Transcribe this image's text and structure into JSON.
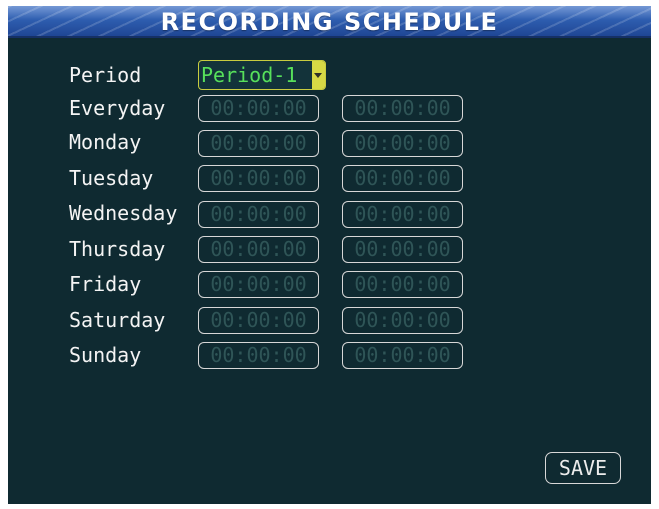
{
  "window": {
    "title": "RECORDING SCHEDULE"
  },
  "period": {
    "label": "Period",
    "value": "Period-1"
  },
  "schedule": {
    "rows": [
      {
        "day": "Everyday",
        "start": "00:00:00",
        "end": "00:00:00"
      },
      {
        "day": "Monday",
        "start": "00:00:00",
        "end": "00:00:00"
      },
      {
        "day": "Tuesday",
        "start": "00:00:00",
        "end": "00:00:00"
      },
      {
        "day": "Wednesday",
        "start": "00:00:00",
        "end": "00:00:00"
      },
      {
        "day": "Thursday",
        "start": "00:00:00",
        "end": "00:00:00"
      },
      {
        "day": "Friday",
        "start": "00:00:00",
        "end": "00:00:00"
      },
      {
        "day": "Saturday",
        "start": "00:00:00",
        "end": "00:00:00"
      },
      {
        "day": "Sunday",
        "start": "00:00:00",
        "end": "00:00:00"
      }
    ]
  },
  "actions": {
    "save_label": "SAVE"
  },
  "theme": {
    "background": "#0f2a31",
    "title_bar": "#2f5fb1",
    "label_text": "#f4f4f4",
    "period_text": "#57e05b",
    "period_border": "#c8cc3f",
    "time_text": "#2f5557",
    "field_border": "#d7d7d7"
  },
  "icons": {
    "period_dropdown": "chevron-down-icon"
  }
}
